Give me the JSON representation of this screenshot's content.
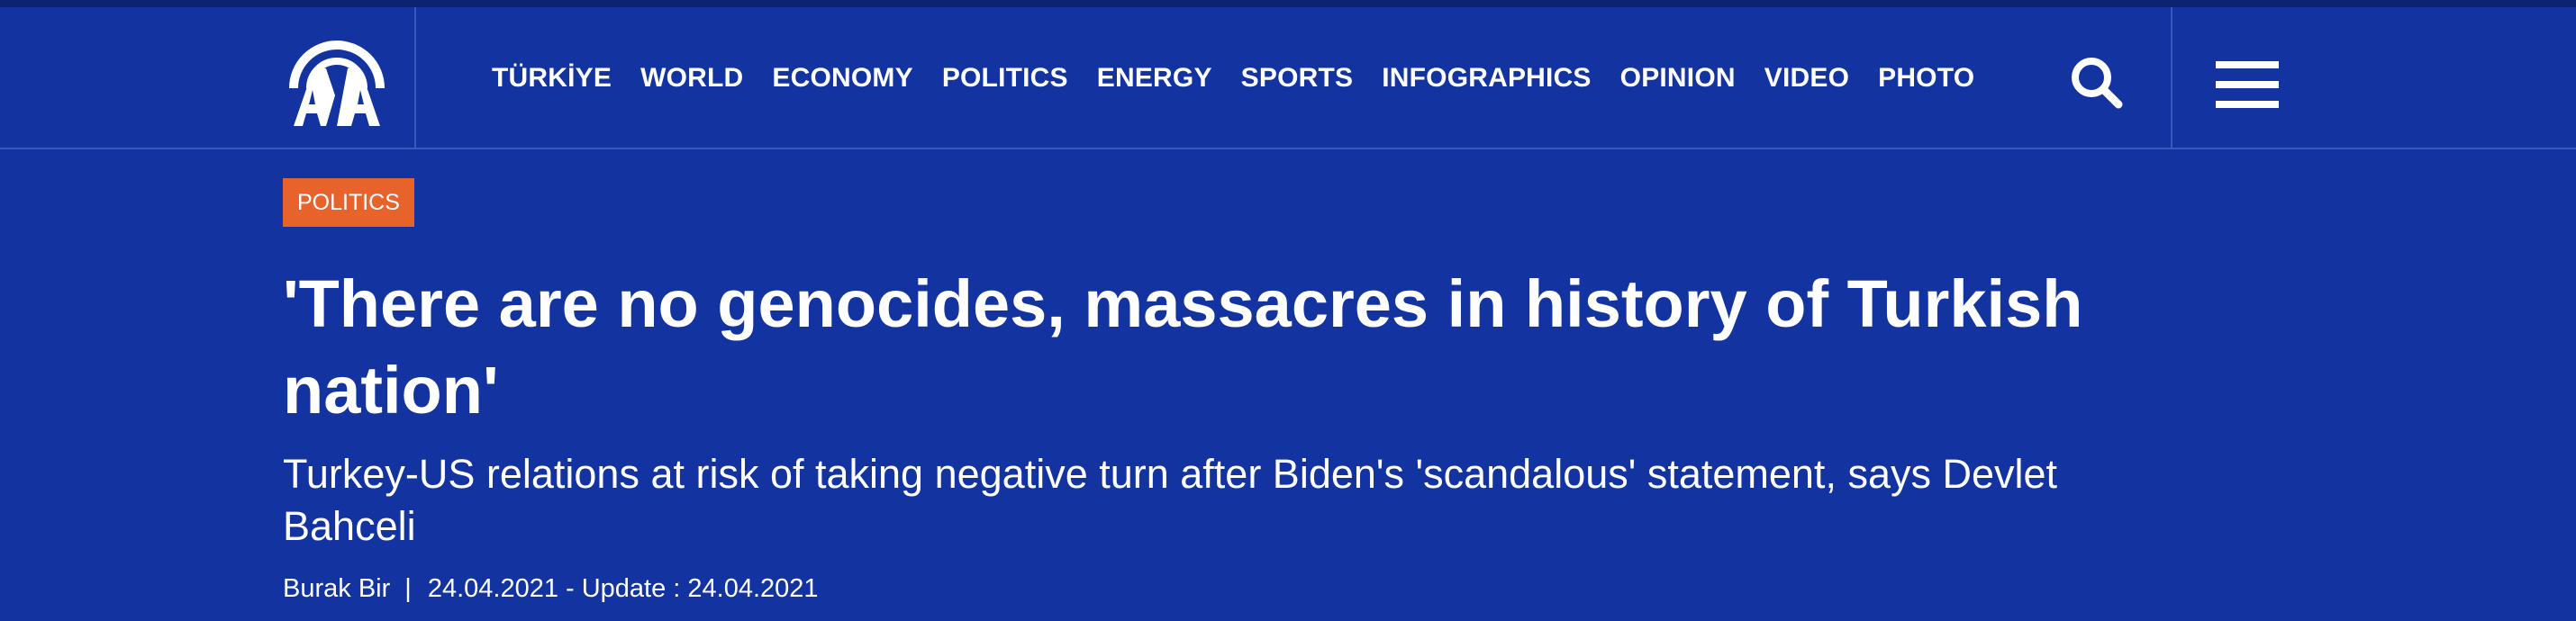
{
  "brand": {
    "logo_text": "AA",
    "logo_icon": "aa-logo-icon"
  },
  "nav": {
    "items": [
      {
        "label": "TÜRKİYE"
      },
      {
        "label": "WORLD"
      },
      {
        "label": "ECONOMY"
      },
      {
        "label": "POLITICS"
      },
      {
        "label": "ENERGY"
      },
      {
        "label": "SPORTS"
      },
      {
        "label": "INFOGRAPHICS"
      },
      {
        "label": "OPINION"
      },
      {
        "label": "VIDEO"
      },
      {
        "label": "PHOTO"
      }
    ],
    "search_icon": "search-icon",
    "menu_icon": "hamburger-menu-icon"
  },
  "article": {
    "category": "POLITICS",
    "headline": "'There are no genocides, massacres in history of Turkish nation'",
    "subtitle": "Turkey-US relations at risk of taking negative turn after Biden's 'scandalous' statement, says Devlet Bahceli",
    "author": "Burak Bir",
    "separator": "|",
    "dates": "24.04.2021 - Update : 24.04.2021"
  },
  "colors": {
    "background": "#1233a0",
    "top_strip": "#0d2270",
    "divider": "#3b57b8",
    "badge": "#e8622c",
    "text": "#ffffff"
  }
}
